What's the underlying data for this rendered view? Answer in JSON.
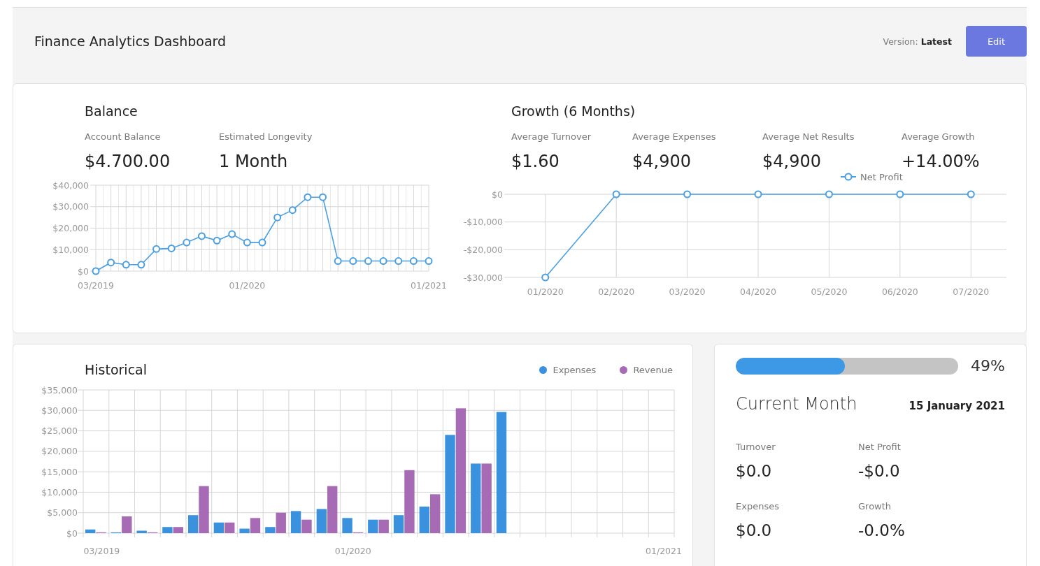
{
  "header": {
    "title": "Finance Analytics Dashboard",
    "version_label": "Version:",
    "version_value": "Latest",
    "edit_button": "Edit"
  },
  "balance": {
    "title": "Balance",
    "stats": [
      {
        "label": "Account Balance",
        "value": "$4.700.00"
      },
      {
        "label": "Estimated Longevity",
        "value": "1 Month"
      }
    ],
    "chart_data": {
      "type": "line",
      "grid": true,
      "categories": [
        "03/2019",
        null,
        null,
        null,
        null,
        null,
        null,
        null,
        null,
        null,
        "01/2020",
        null,
        null,
        null,
        null,
        null,
        null,
        null,
        null,
        null,
        null,
        null,
        "01/2021"
      ],
      "series": [
        {
          "color": "#4a9fe3",
          "marker": "circle",
          "values": [
            0,
            4000,
            3000,
            3000,
            10300,
            10600,
            13300,
            16300,
            14200,
            17200,
            13300,
            13300,
            25000,
            28400,
            34400,
            34400,
            4700,
            4700,
            4700,
            4700,
            4700,
            4700,
            4700
          ]
        }
      ],
      "ylim": [
        0,
        40000
      ],
      "yticks": [
        {
          "value": 0,
          "label": "$0"
        },
        {
          "value": 10000,
          "label": "$10,000"
        },
        {
          "value": 20000,
          "label": "$20,000"
        },
        {
          "value": 30000,
          "label": "$30,000"
        },
        {
          "value": 40000,
          "label": "$40,000"
        }
      ]
    }
  },
  "growth": {
    "title": "Growth (6 Months)",
    "stats": [
      {
        "label": "Average Turnover",
        "value": "$1.60"
      },
      {
        "label": "Average Expenses",
        "value": "$4,900"
      },
      {
        "label": "Average Net Results",
        "value": "$4,900"
      },
      {
        "label": "Average Growth",
        "value": "+14.00%"
      }
    ],
    "chart_data": {
      "type": "line",
      "grid": true,
      "categories": [
        "01/2020",
        "02/2020",
        "03/2020",
        "04/2020",
        "05/2020",
        "06/2020",
        "07/2020"
      ],
      "series": [
        {
          "name": "Net Profit",
          "color": "#4a9fe3",
          "marker": "circle",
          "values": [
            -30000,
            0,
            0,
            0,
            0,
            0,
            0
          ]
        }
      ],
      "ylim": [
        -30000,
        0
      ],
      "yticks": [
        {
          "value": 0,
          "label": "$0"
        },
        {
          "value": -10000,
          "label": "-$10,000"
        },
        {
          "value": -20000,
          "label": "-$20,000"
        },
        {
          "value": -30000,
          "label": "-$30,000"
        }
      ]
    }
  },
  "historical": {
    "title": "Historical",
    "chart_data": {
      "type": "bar",
      "grid": true,
      "categories": [
        "03/2019",
        null,
        null,
        null,
        null,
        null,
        null,
        null,
        null,
        null,
        "01/2020",
        null,
        null,
        null,
        null,
        null,
        null,
        null,
        null,
        null,
        null,
        null,
        "01/2021"
      ],
      "series": [
        {
          "name": "Expenses",
          "color": "#3a91de",
          "values": [
            900,
            200,
            600,
            1500,
            4400,
            2600,
            1100,
            1500,
            5400,
            5900,
            3700,
            3300,
            4400,
            6500,
            24000,
            17000,
            29600,
            null,
            null,
            null,
            null,
            null,
            null
          ]
        },
        {
          "name": "Revenue",
          "color": "#a76ab4",
          "values": [
            200,
            4100,
            200,
            1500,
            11500,
            2600,
            3700,
            5000,
            3300,
            11500,
            200,
            3300,
            15400,
            9500,
            30500,
            17000,
            null,
            null,
            null,
            null,
            null,
            null,
            null
          ]
        }
      ],
      "ylim": [
        0,
        35000
      ],
      "yticks": [
        {
          "value": 0,
          "label": "$0"
        },
        {
          "value": 5000,
          "label": "$5,000"
        },
        {
          "value": 10000,
          "label": "$10,000"
        },
        {
          "value": 15000,
          "label": "$15,000"
        },
        {
          "value": 20000,
          "label": "$20,000"
        },
        {
          "value": 25000,
          "label": "$25,000"
        },
        {
          "value": 30000,
          "label": "$30,000"
        },
        {
          "value": 35000,
          "label": "$35,000"
        }
      ]
    }
  },
  "current_month": {
    "progress": {
      "level": 0.49,
      "reading": "49%"
    },
    "title": "Current Month",
    "date": "15 January 2021",
    "stats": [
      {
        "label": "Turnover",
        "value": "$0.0"
      },
      {
        "label": "Net Profit",
        "value": "-$0.0"
      },
      {
        "label": "Expenses",
        "value": "$0.0"
      },
      {
        "label": "Growth",
        "value": "-0.0%"
      }
    ]
  }
}
